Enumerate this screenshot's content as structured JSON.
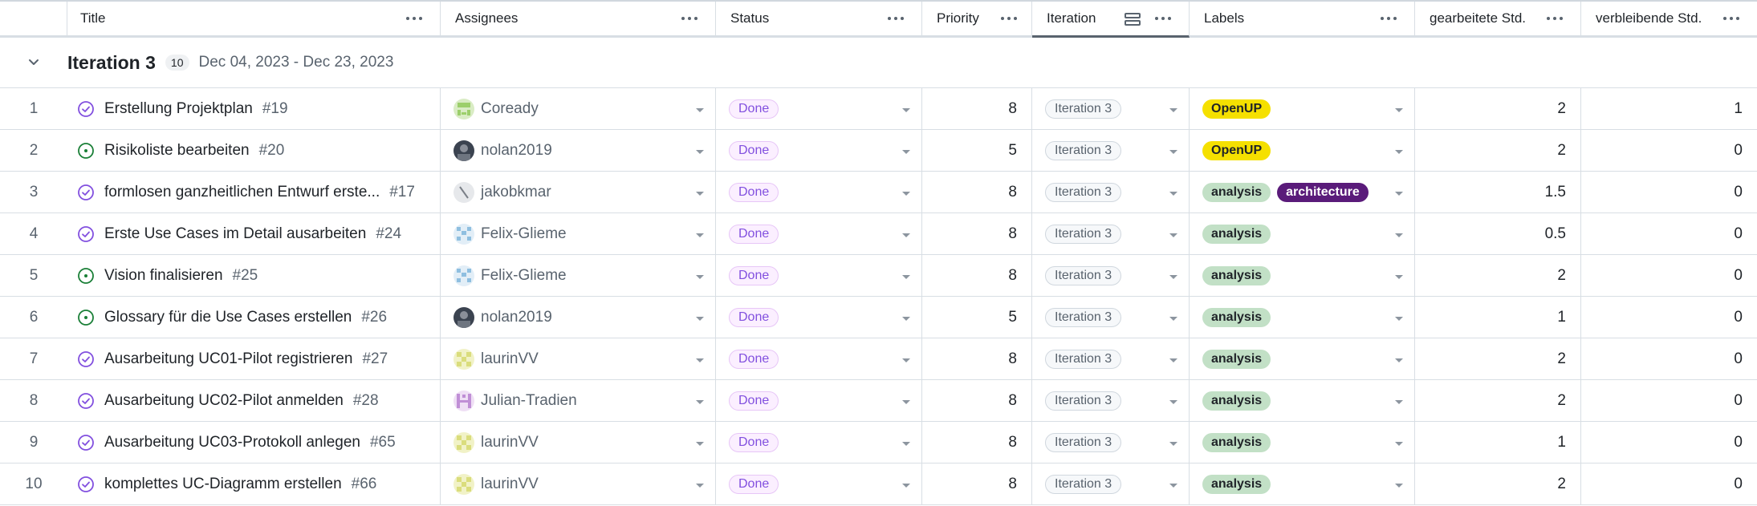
{
  "columns": {
    "title": "Title",
    "assignees": "Assignees",
    "status": "Status",
    "priority": "Priority",
    "iteration": "Iteration",
    "labels": "Labels",
    "worked": "gearbeitete Std.",
    "remaining": "verbleibende Std."
  },
  "group": {
    "title": "Iteration 3",
    "count": "10",
    "dates": "Dec 04, 2023 - Dec 23, 2023"
  },
  "colors": {
    "done_state": "#8250df",
    "open_state": "#1a7f37",
    "openup_label": "#f5e000",
    "analysis_label": "#c2e0c6",
    "architecture_label": "#5a1b7a"
  },
  "rows": [
    {
      "num": "1",
      "state": "done",
      "title": "Erstellung Projektplan",
      "issue": "#19",
      "assignee": "Coready",
      "avatar": "coready",
      "status": "Done",
      "priority": "8",
      "iteration": "Iteration 3",
      "labels": [
        {
          "text": "OpenUP",
          "kind": "openup"
        }
      ],
      "worked": "2",
      "remaining": "1"
    },
    {
      "num": "2",
      "state": "open",
      "title": "Risikoliste bearbeiten",
      "issue": "#20",
      "assignee": "nolan2019",
      "avatar": "nolan",
      "status": "Done",
      "priority": "5",
      "iteration": "Iteration 3",
      "labels": [
        {
          "text": "OpenUP",
          "kind": "openup"
        }
      ],
      "worked": "2",
      "remaining": "0"
    },
    {
      "num": "3",
      "state": "done",
      "title": "formlosen ganzheitlichen Entwurf erste...",
      "issue": "#17",
      "assignee": "jakobkmar",
      "avatar": "jakob",
      "status": "Done",
      "priority": "8",
      "iteration": "Iteration 3",
      "labels": [
        {
          "text": "analysis",
          "kind": "analysis"
        },
        {
          "text": "architecture",
          "kind": "architecture"
        }
      ],
      "worked": "1.5",
      "remaining": "0"
    },
    {
      "num": "4",
      "state": "done",
      "title": "Erste Use Cases im Detail ausarbeiten",
      "issue": "#24",
      "assignee": "Felix-Glieme",
      "avatar": "felix",
      "status": "Done",
      "priority": "8",
      "iteration": "Iteration 3",
      "labels": [
        {
          "text": "analysis",
          "kind": "analysis"
        }
      ],
      "worked": "0.5",
      "remaining": "0"
    },
    {
      "num": "5",
      "state": "open",
      "title": "Vision finalisieren",
      "issue": "#25",
      "assignee": "Felix-Glieme",
      "avatar": "felix",
      "status": "Done",
      "priority": "8",
      "iteration": "Iteration 3",
      "labels": [
        {
          "text": "analysis",
          "kind": "analysis"
        }
      ],
      "worked": "2",
      "remaining": "0"
    },
    {
      "num": "6",
      "state": "open",
      "title": "Glossary für die Use Cases erstellen",
      "issue": "#26",
      "assignee": "nolan2019",
      "avatar": "nolan",
      "status": "Done",
      "priority": "5",
      "iteration": "Iteration 3",
      "labels": [
        {
          "text": "analysis",
          "kind": "analysis"
        }
      ],
      "worked": "1",
      "remaining": "0"
    },
    {
      "num": "7",
      "state": "done",
      "title": "Ausarbeitung UC01-Pilot registrieren",
      "issue": "#27",
      "assignee": "laurinVV",
      "avatar": "laurin",
      "status": "Done",
      "priority": "8",
      "iteration": "Iteration 3",
      "labels": [
        {
          "text": "analysis",
          "kind": "analysis"
        }
      ],
      "worked": "2",
      "remaining": "0"
    },
    {
      "num": "8",
      "state": "done",
      "title": "Ausarbeitung UC02-Pilot anmelden",
      "issue": "#28",
      "assignee": "Julian-Tradien",
      "avatar": "julian",
      "status": "Done",
      "priority": "8",
      "iteration": "Iteration 3",
      "labels": [
        {
          "text": "analysis",
          "kind": "analysis"
        }
      ],
      "worked": "2",
      "remaining": "0"
    },
    {
      "num": "9",
      "state": "done",
      "title": "Ausarbeitung UC03-Protokoll anlegen",
      "issue": "#65",
      "assignee": "laurinVV",
      "avatar": "laurin",
      "status": "Done",
      "priority": "8",
      "iteration": "Iteration 3",
      "labels": [
        {
          "text": "analysis",
          "kind": "analysis"
        }
      ],
      "worked": "1",
      "remaining": "0"
    },
    {
      "num": "10",
      "state": "done",
      "title": "komplettes UC-Diagramm erstellen",
      "issue": "#66",
      "assignee": "laurinVV",
      "avatar": "laurin",
      "status": "Done",
      "priority": "8",
      "iteration": "Iteration 3",
      "labels": [
        {
          "text": "analysis",
          "kind": "analysis"
        }
      ],
      "worked": "2",
      "remaining": "0"
    }
  ]
}
